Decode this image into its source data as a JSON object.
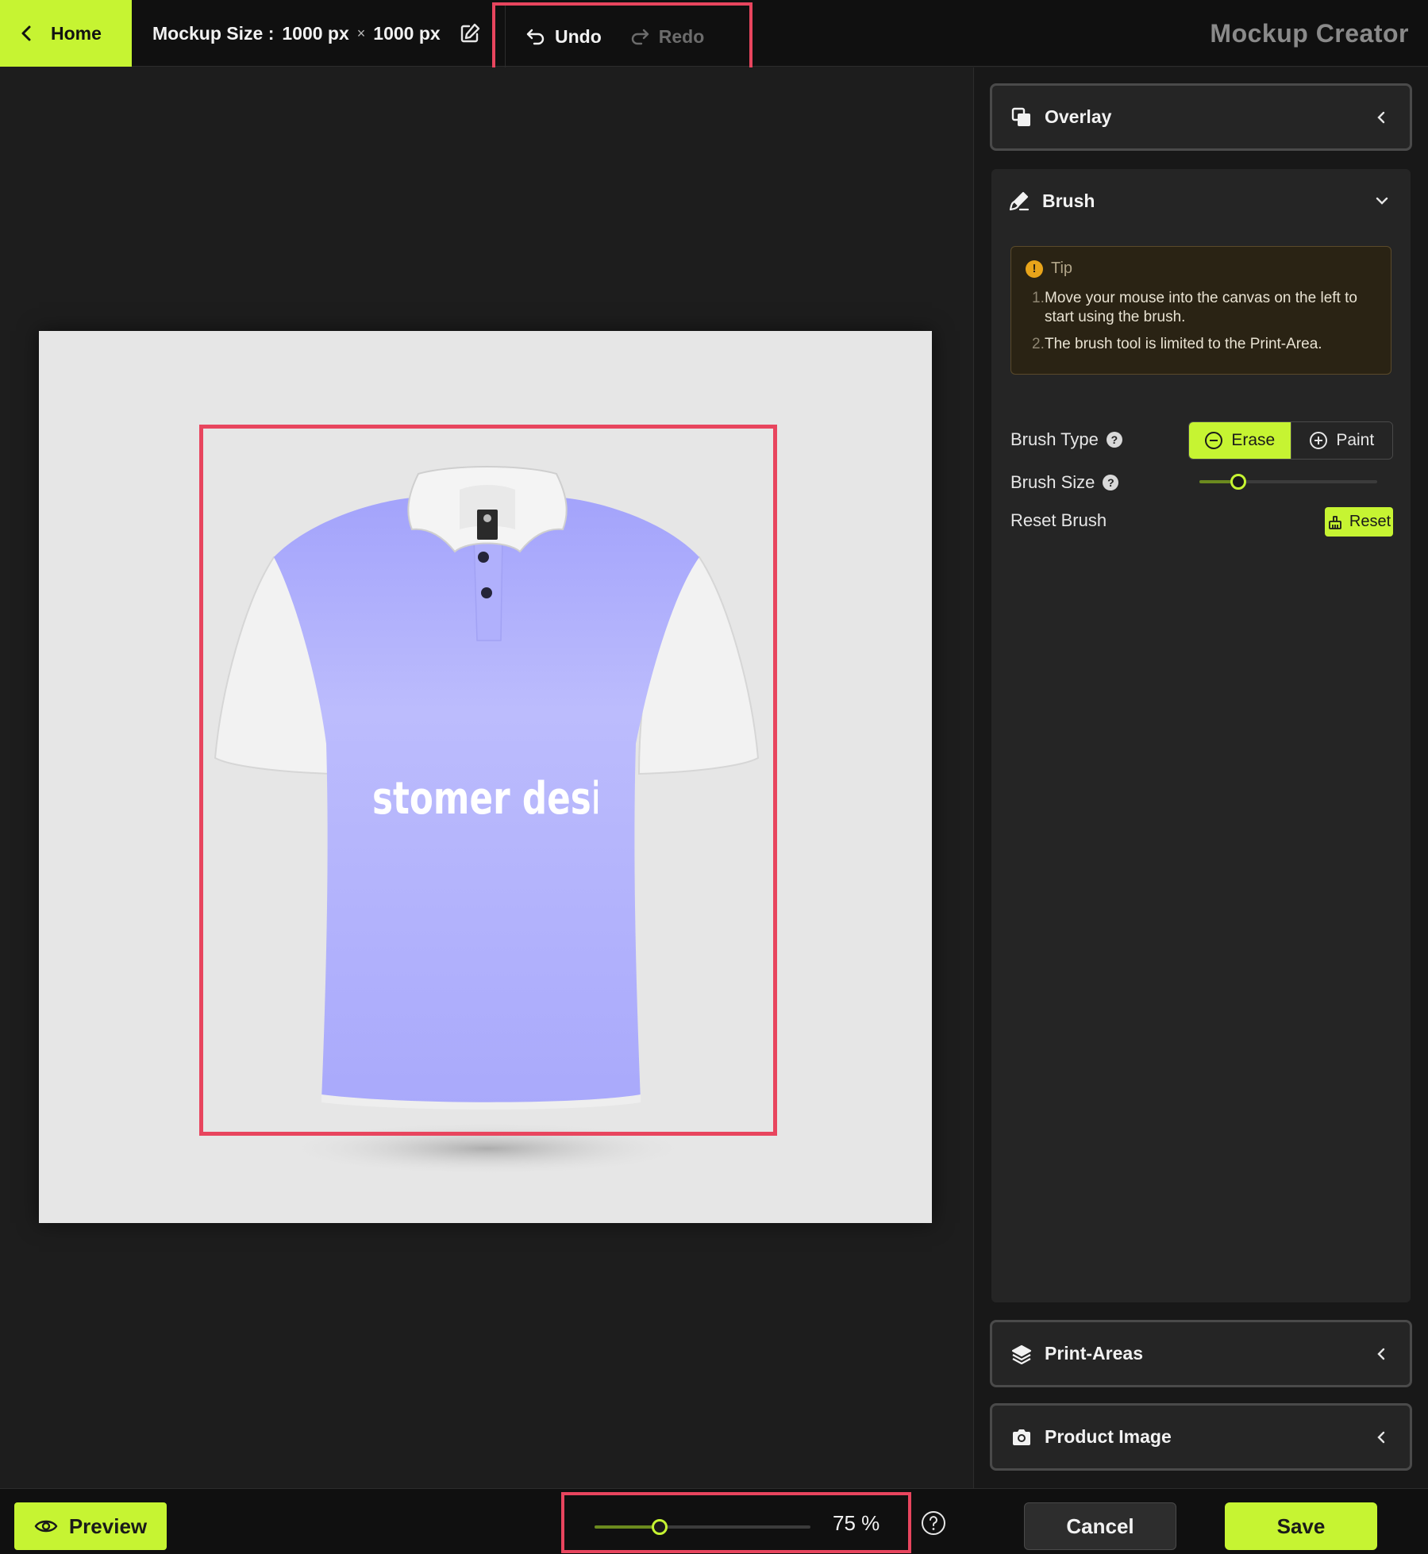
{
  "header": {
    "home_label": "Home",
    "mockup_size_label": "Mockup Size :",
    "width_value": "1000 px",
    "times": "×",
    "height_value": "1000 px",
    "undo_label": "Undo",
    "redo_label": "Redo",
    "app_title": "Mockup Creator"
  },
  "canvas": {
    "design_text": "stomer design he"
  },
  "sidebar": {
    "overlay_label": "Overlay",
    "brush_label": "Brush",
    "tip": {
      "title": "Tip",
      "items": [
        {
          "num": "1.",
          "text": "Move your mouse into the canvas on the left to start using the brush."
        },
        {
          "num": "2.",
          "text": "The brush tool is limited to the Print-Area."
        }
      ]
    },
    "brush_type_label": "Brush Type",
    "erase_label": "Erase",
    "paint_label": "Paint",
    "selected_brush_type": "Erase",
    "brush_size_label": "Brush Size",
    "brush_size_fraction": 0.22,
    "reset_brush_label": "Reset Brush",
    "reset_label": "Reset",
    "print_areas_label": "Print-Areas",
    "product_image_label": "Product Image"
  },
  "footer": {
    "preview_label": "Preview",
    "zoom_value": "75 %",
    "zoom_fraction": 0.3,
    "cancel_label": "Cancel",
    "save_label": "Save"
  },
  "colors": {
    "accent": "#c6f432",
    "highlight_border": "#e8455e",
    "shirt_body": "#b3b3fb",
    "background": "#1d1d1d"
  }
}
